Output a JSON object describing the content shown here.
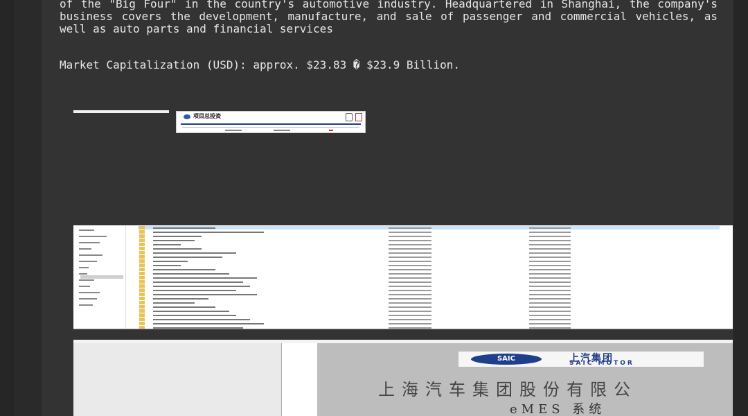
{
  "article": {
    "paragraph1": "of the \"Big Four\" in the country's automotive industry. Headquartered in Shanghai, the company's business covers the development, manufacture, and sale of passenger and commercial vehicles, as well as auto parts and financial services",
    "paragraph2": "Market Capitalization (USD): approx. $23.83 � $23.9 Billion."
  },
  "thumbnail_doc": {
    "title": "项目总投资"
  },
  "saic_screenshot": {
    "logo_text": "SAIC",
    "brand_cn": "上汽集团",
    "brand_en": "SAIC MOTOR",
    "company_cn": "上海汽车集团股份有限公",
    "system_label": "eMES 系统"
  },
  "colors": {
    "background": "#262626",
    "panel": "#333333",
    "text": "#e6e6e6",
    "saic_blue": "#1f3e8c",
    "folder": "#e8c35a"
  }
}
